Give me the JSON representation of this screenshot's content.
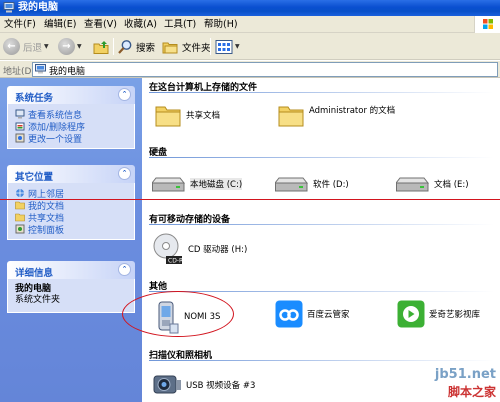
{
  "window": {
    "title": "我的电脑"
  },
  "menu": {
    "items": [
      "文件(F)",
      "编辑(E)",
      "查看(V)",
      "收藏(A)",
      "工具(T)",
      "帮助(H)"
    ]
  },
  "toolbar": {
    "back_label": "后退",
    "search_label": "搜索",
    "folders_label": "文件夹"
  },
  "address": {
    "label": "地址(D)",
    "value": "我的电脑"
  },
  "left": {
    "system_tasks": {
      "title": "系统任务",
      "items": [
        "查看系统信息",
        "添加/删除程序",
        "更改一个设置"
      ]
    },
    "other_places": {
      "title": "其它位置",
      "items": [
        "网上邻居",
        "我的文档",
        "共享文档",
        "控制面板"
      ]
    },
    "details": {
      "title": "详细信息",
      "name": "我的电脑",
      "desc": "系统文件夹"
    }
  },
  "main": {
    "sections": {
      "stored": "在这台计算机上存储的文件",
      "hdd": "硬盘",
      "removable": "有可移动存储的设备",
      "other": "其他",
      "scanners": "扫描仪和照相机"
    },
    "stored_items": [
      "共享文档",
      "Administrator 的文档"
    ],
    "hdd_items": [
      "本地磁盘 (C:)",
      "软件 (D:)",
      "文档 (E:)"
    ],
    "removable_items": [
      "CD 驱动器 (H:)"
    ],
    "other_items": [
      "NOMI 3S",
      "百度云管家",
      "爱奇艺影视库"
    ],
    "scanner_items": [
      "USB 视频设备 #3"
    ]
  },
  "watermark": {
    "site": "jb51.net",
    "brand": "脚本之家"
  },
  "colors": {
    "title_bar": "#0a4fd0",
    "task_pane": "#6b8ee0",
    "link": "#215dc6",
    "annotation": "#d2141e"
  }
}
